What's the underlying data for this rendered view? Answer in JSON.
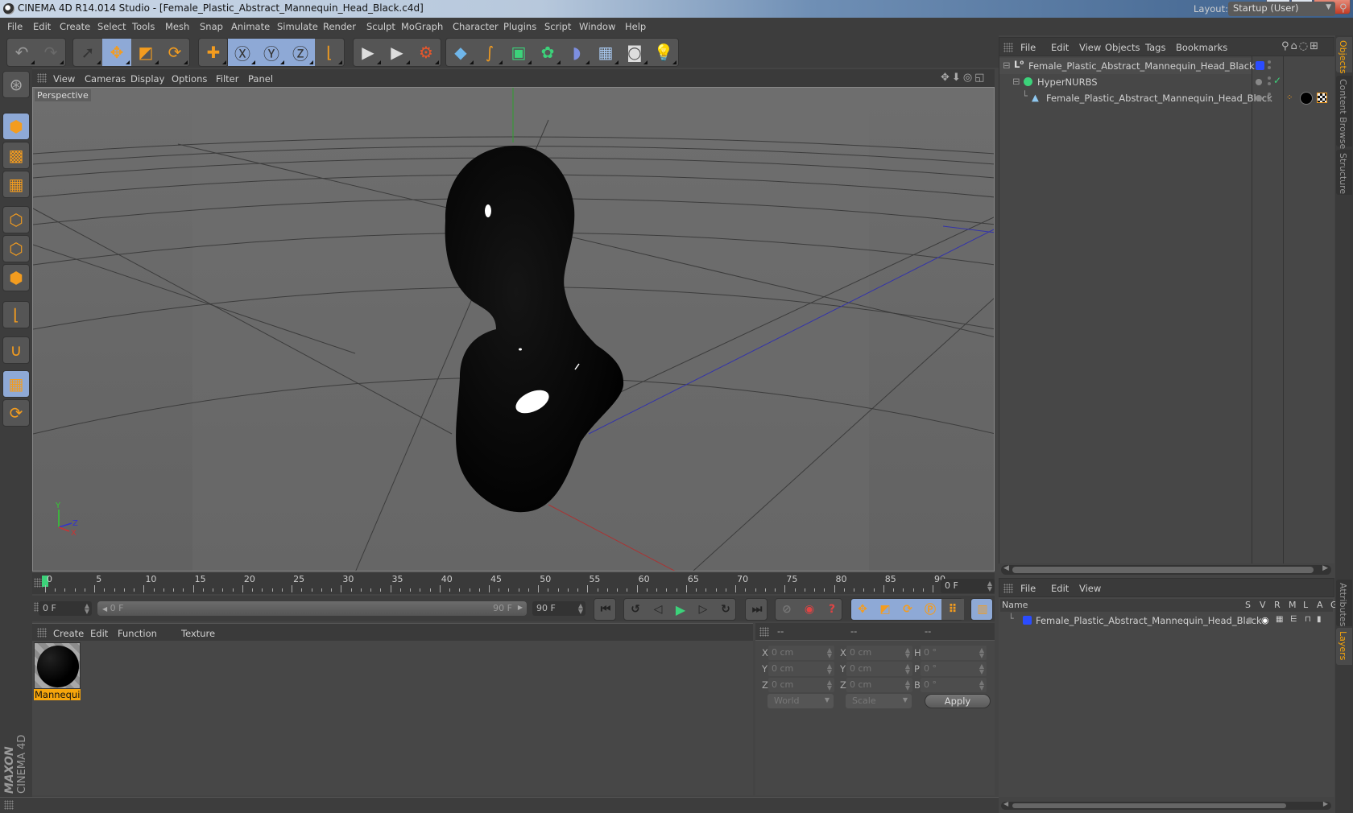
{
  "window": {
    "title": "CINEMA 4D R14.014 Studio - [Female_Plastic_Abstract_Mannequin_Head_Black.c4d]",
    "controls": [
      "minimize",
      "maximize",
      "close"
    ]
  },
  "menubar": {
    "items": [
      "File",
      "Edit",
      "Create",
      "Select",
      "Tools",
      "Mesh",
      "Snap",
      "Animate",
      "Simulate",
      "Render",
      "Sculpt",
      "MoGraph",
      "Character",
      "Plugins",
      "Script",
      "Window",
      "Help"
    ],
    "layout_label": "Layout:",
    "layout_value": "Startup (User)"
  },
  "toolbar": {
    "groups": [
      {
        "name": "history",
        "buttons": [
          {
            "icon": "undo-icon",
            "glyph": "↶",
            "color": "#9a9a9a",
            "active": false
          },
          {
            "icon": "redo-icon",
            "glyph": "↷",
            "color": "#6a6a6a",
            "active": false
          }
        ]
      },
      {
        "name": "tools",
        "buttons": [
          {
            "icon": "live-selection-icon",
            "glyph": "➚",
            "color": "#333",
            "active": false
          },
          {
            "icon": "move-icon",
            "glyph": "✥",
            "color": "#f39c1f",
            "active": true
          },
          {
            "icon": "scale-icon",
            "glyph": "◩",
            "color": "#f39c1f",
            "active": false
          },
          {
            "icon": "rotate-icon",
            "glyph": "⟳",
            "color": "#f39c1f",
            "active": false
          }
        ]
      },
      {
        "name": "last-tool",
        "buttons": [
          {
            "icon": "last-tool-icon",
            "glyph": "✚",
            "color": "#f39c1f",
            "active": false
          }
        ]
      },
      {
        "name": "axes",
        "buttons": [
          {
            "icon": "x-axis-icon",
            "glyph": "Ⓧ",
            "color": "#333",
            "active": true
          },
          {
            "icon": "y-axis-icon",
            "glyph": "Ⓨ",
            "color": "#333",
            "active": true
          },
          {
            "icon": "z-axis-icon",
            "glyph": "Ⓩ",
            "color": "#333",
            "active": true
          },
          {
            "icon": "coordinate-system-icon",
            "glyph": "⌊",
            "color": "#f39c1f",
            "active": false
          }
        ]
      },
      {
        "name": "render",
        "buttons": [
          {
            "icon": "render-view-icon",
            "glyph": "▶",
            "color": "#ddd",
            "active": false
          },
          {
            "icon": "render-picture-viewer-icon",
            "glyph": "▶",
            "color": "#ddd",
            "active": false
          },
          {
            "icon": "render-settings-icon",
            "glyph": "⚙",
            "color": "#e8562c",
            "active": false
          }
        ]
      },
      {
        "name": "objects",
        "buttons": [
          {
            "icon": "cube-icon",
            "glyph": "◆",
            "color": "#6fb6ea",
            "active": false
          },
          {
            "icon": "spline-pen-icon",
            "glyph": "∫",
            "color": "#f39c1f",
            "active": false
          },
          {
            "icon": "subdivision-surface-icon",
            "glyph": "▣",
            "color": "#3cd27a",
            "active": false
          },
          {
            "icon": "cloner-icon",
            "glyph": "✿",
            "color": "#3cd27a",
            "active": false
          },
          {
            "icon": "bend-deformer-icon",
            "glyph": "◗",
            "color": "#7d8fe0",
            "active": false
          },
          {
            "icon": "floor-icon",
            "glyph": "▦",
            "color": "#a7c7ee",
            "active": false
          },
          {
            "icon": "camera-icon",
            "glyph": "◙",
            "color": "#ddd",
            "active": false
          },
          {
            "icon": "light-icon",
            "glyph": "💡",
            "color": "#eee",
            "active": false
          }
        ]
      }
    ]
  },
  "left_tools": [
    {
      "icon": "make-editable-icon",
      "glyph": "⊛",
      "active": false
    },
    {
      "icon": "model-mode-icon",
      "glyph": "⬢",
      "active": true
    },
    {
      "icon": "texture-mode-icon",
      "glyph": "▩",
      "active": false
    },
    {
      "icon": "workplane-mode-icon",
      "glyph": "▦",
      "active": false
    },
    {
      "icon": "points-mode-icon",
      "glyph": "⬡",
      "active": false
    },
    {
      "icon": "edges-mode-icon",
      "glyph": "⬡",
      "active": false
    },
    {
      "icon": "polygons-mode-icon",
      "glyph": "⬢",
      "active": false
    },
    {
      "icon": "axis-mode-icon",
      "glyph": "⌊",
      "active": false
    },
    {
      "icon": "snap-magnet-icon",
      "glyph": "∪",
      "active": false
    },
    {
      "icon": "locked-workplane-icon",
      "glyph": "▦",
      "active": true
    },
    {
      "icon": "planar-workplane-icon",
      "glyph": "⟳",
      "active": false
    }
  ],
  "logo": {
    "brand": "MAXON",
    "product": "CINEMA 4D"
  },
  "viewport": {
    "menu": [
      "View",
      "Cameras",
      "Display",
      "Options",
      "Filter",
      "Panel"
    ],
    "camera_label": "Perspective",
    "nav_icons": [
      "move-view-icon",
      "zoom-view-icon",
      "rotate-view-icon",
      "toggle-layout-icon"
    ],
    "axis_labels": {
      "x": "X",
      "y": "Y",
      "z": "Z"
    }
  },
  "timeline": {
    "ticks": [
      0,
      5,
      10,
      15,
      20,
      25,
      30,
      35,
      40,
      45,
      50,
      55,
      60,
      65,
      70,
      75,
      80,
      85,
      90
    ],
    "min_frame": 0,
    "max_frame": 90,
    "current_frame": 0,
    "current_frame_field": "0 F"
  },
  "transport": {
    "start_field": "0 F",
    "range_start": "0 F",
    "range_end": "90 F",
    "end_field": "90 F",
    "buttons": [
      "go-to-start-icon",
      "previous-key-icon",
      "previous-frame-icon",
      "play-forward-icon",
      "next-frame-icon",
      "next-key-icon",
      "go-to-end-icon",
      "record-active-objects-icon",
      "autokeying-icon",
      "keyframe-selection-icon",
      "record-position-icon",
      "record-scale-icon",
      "record-rotation-icon",
      "record-parameter-icon",
      "record-point-level-icon",
      "timeline-window-icon"
    ]
  },
  "material_manager": {
    "menu": [
      "Create",
      "Edit",
      "Function",
      "Texture"
    ],
    "materials": [
      {
        "name": "Mannequin",
        "selected": true
      }
    ]
  },
  "coordinates": {
    "headers": [
      "--",
      "--",
      "--"
    ],
    "rows": [
      {
        "pos_label": "X",
        "pos": "0 cm",
        "size_label": "X",
        "size": "0 cm",
        "rot_label": "H",
        "rot": "0 °"
      },
      {
        "pos_label": "Y",
        "pos": "0 cm",
        "size_label": "Y",
        "size": "0 cm",
        "rot_label": "P",
        "rot": "0 °"
      },
      {
        "pos_label": "Z",
        "pos": "0 cm",
        "size_label": "Z",
        "size": "0 cm",
        "rot_label": "B",
        "rot": "0 °"
      }
    ],
    "space_select": "World",
    "mode_select": "Scale",
    "apply_label": "Apply"
  },
  "object_manager": {
    "menu": [
      "File",
      "Edit",
      "View",
      "Objects",
      "Tags",
      "Bookmarks"
    ],
    "objects": [
      {
        "name": "Female_Plastic_Abstract_Mannequin_Head_Black",
        "type": "null-object-icon",
        "depth": 0,
        "layer_color": "#2b4cff"
      },
      {
        "name": "HyperNURBS",
        "type": "hypernurbs-icon",
        "depth": 1,
        "enabled": true
      },
      {
        "name": "Female_Plastic_Abstract_Mannequin_Head_Black",
        "type": "polygon-object-icon",
        "depth": 2,
        "tags": [
          "phong-tag-icon",
          "material-tag-icon",
          "texture-tag-icon"
        ]
      }
    ]
  },
  "layer_manager": {
    "menu": [
      "File",
      "Edit",
      "View"
    ],
    "columns": [
      "Name",
      "S",
      "V",
      "R",
      "M",
      "L",
      "A",
      "G"
    ],
    "layers": [
      {
        "name": "Female_Plastic_Abstract_Mannequin_Head_Black",
        "color": "#2b4cff"
      }
    ]
  },
  "right_tabs": {
    "top": [
      {
        "label": "Objects",
        "active": true
      },
      {
        "label": "Content Browser",
        "active": false
      },
      {
        "label": "Structure",
        "active": false
      }
    ],
    "bottom": [
      {
        "label": "Attributes",
        "active": false
      },
      {
        "label": "Layers",
        "active": true
      }
    ]
  },
  "colors": {
    "accent_orange": "#f6a50c",
    "active_blue": "#8ea9d6",
    "play_green": "#3cd27a"
  }
}
